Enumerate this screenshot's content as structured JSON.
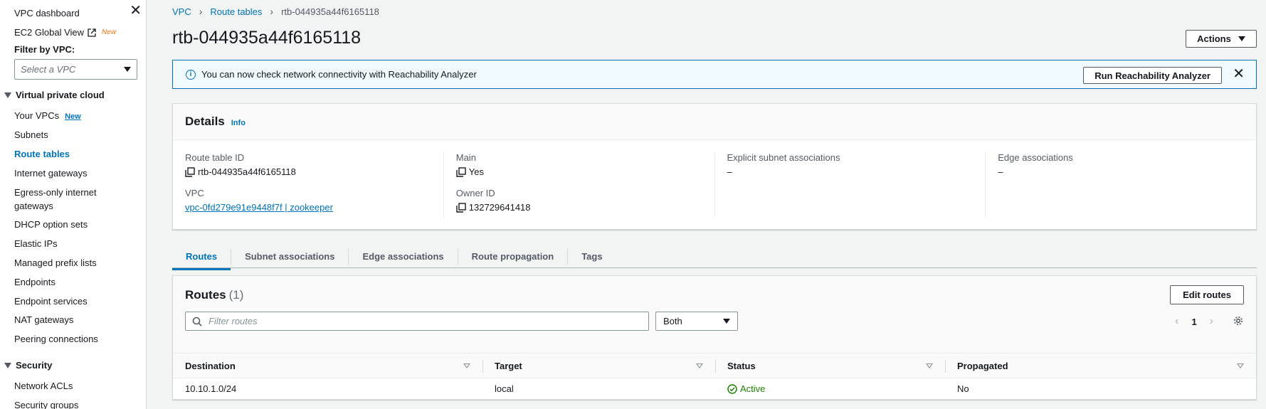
{
  "sidebar": {
    "dashboard": "VPC dashboard",
    "ec2_global_view": "EC2 Global View",
    "ec2_new_badge": "New",
    "filter_label": "Filter by VPC:",
    "filter_placeholder": "Select a VPC",
    "vpc_section": "Virtual private cloud",
    "items": [
      {
        "label": "Your VPCs",
        "badge": "New"
      },
      {
        "label": "Subnets"
      },
      {
        "label": "Route tables"
      },
      {
        "label": "Internet gateways"
      },
      {
        "label": "Egress-only internet gateways"
      },
      {
        "label": "DHCP option sets"
      },
      {
        "label": "Elastic IPs"
      },
      {
        "label": "Managed prefix lists"
      },
      {
        "label": "Endpoints"
      },
      {
        "label": "Endpoint services"
      },
      {
        "label": "NAT gateways"
      },
      {
        "label": "Peering connections"
      }
    ],
    "security_section": "Security",
    "security_items": [
      {
        "label": "Network ACLs"
      },
      {
        "label": "Security groups"
      }
    ]
  },
  "breadcrumb": {
    "vpc": "VPC",
    "route_tables": "Route tables",
    "current": "rtb-044935a44f6165118"
  },
  "page": {
    "title": "rtb-044935a44f6165118",
    "actions_label": "Actions"
  },
  "flash": {
    "message": "You can now check network connectivity with Reachability Analyzer",
    "button": "Run Reachability Analyzer"
  },
  "details": {
    "title": "Details",
    "info": "Info",
    "route_table_id_label": "Route table ID",
    "route_table_id": "rtb-044935a44f6165118",
    "vpc_label": "VPC",
    "vpc_value": "vpc-0fd279e91e9448f7f | zookeeper",
    "main_label": "Main",
    "main_value": "Yes",
    "owner_label": "Owner ID",
    "owner_value": "132729641418",
    "explicit_label": "Explicit subnet associations",
    "explicit_value": "–",
    "edge_label": "Edge associations",
    "edge_value": "–"
  },
  "tabs": [
    "Routes",
    "Subnet associations",
    "Edge associations",
    "Route propagation",
    "Tags"
  ],
  "routes": {
    "title": "Routes",
    "count": "(1)",
    "edit_button": "Edit routes",
    "search_placeholder": "Filter routes",
    "filter_value": "Both",
    "page_number": "1",
    "columns": [
      "Destination",
      "Target",
      "Status",
      "Propagated"
    ],
    "rows": [
      {
        "destination": "10.10.1.0/24",
        "target": "local",
        "status": "Active",
        "propagated": "No"
      }
    ]
  },
  "colors": {
    "link": "#0073bb",
    "success": "#1d8102",
    "new_badge": "#ec7211"
  }
}
